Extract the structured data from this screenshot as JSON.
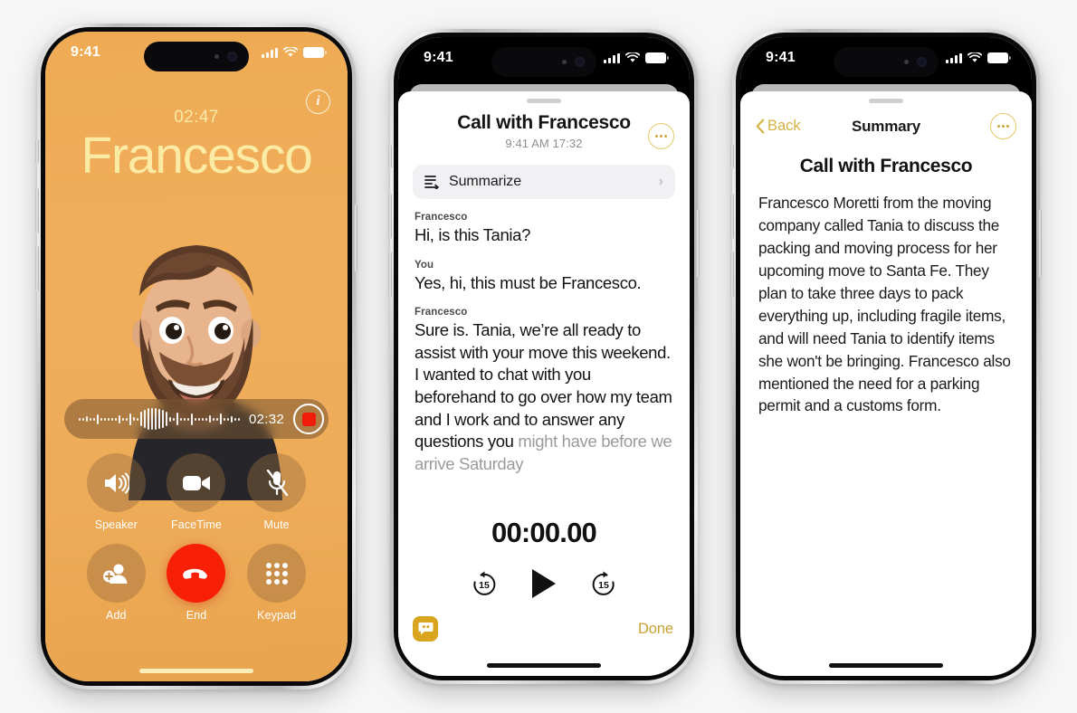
{
  "page": {
    "background_color": "#f6f6f7",
    "accent_gold": "#d4a72c",
    "call_screen_bg": "#efab54",
    "name_color": "#fbeba4",
    "end_button_color": "#f81f07"
  },
  "phone1": {
    "status_bar": {
      "time": "9:41",
      "signal_icon": "cellular-bars-icon",
      "wifi_icon": "wifi-icon",
      "battery_icon": "battery-icon"
    },
    "info_button": "i",
    "call_timer": "02:47",
    "caller_name": "Francesco",
    "avatar": "memoji-avatar",
    "recording": {
      "waveform_icon": "audio-waveform",
      "elapsed": "02:32",
      "record_button": "record-stop-button"
    },
    "controls": [
      {
        "label": "Speaker",
        "icon": "speaker-icon"
      },
      {
        "label": "FaceTime",
        "icon": "video-camera-icon"
      },
      {
        "label": "Mute",
        "icon": "microphone-muted-icon"
      },
      {
        "label": "Add",
        "icon": "add-person-icon"
      },
      {
        "label": "End",
        "icon": "end-call-icon"
      },
      {
        "label": "Keypad",
        "icon": "keypad-grid-icon"
      }
    ]
  },
  "phone2": {
    "status_bar": {
      "time": "9:41"
    },
    "title": "Call with Francesco",
    "subtitle": "9:41 AM  17:32",
    "more_button": "more-options-icon",
    "summarize": {
      "label": "Summarize",
      "icon": "summarize-lines-icon",
      "chevron": "›"
    },
    "transcript": [
      {
        "speaker": "Francesco",
        "text": "Hi, is this Tania?",
        "faded": false
      },
      {
        "speaker": "You",
        "text": "Yes, hi, this must be Francesco.",
        "faded": false
      },
      {
        "speaker": "Francesco",
        "text": "Sure is. Tania, we’re all ready to assist with your move this weekend. I wanted to chat with you beforehand to go over how my team and I work and to answer any questions you ",
        "faded": false,
        "tail": "might have before we arrive Saturday"
      }
    ],
    "player": {
      "time": "00:00.00",
      "rewind_label": "15",
      "forward_label": "15",
      "play_icon": "play-icon",
      "rewind_icon": "rewind-15-icon",
      "forward_icon": "forward-15-icon"
    },
    "footer": {
      "live_icon": "live-transcription-icon",
      "done_label": "Done"
    }
  },
  "phone3": {
    "status_bar": {
      "time": "9:41"
    },
    "back_label": "Back",
    "nav_title": "Summary",
    "more_button": "more-options-icon",
    "summary_title": "Call with Francesco",
    "summary_body": "Francesco Moretti from the moving company called Tania to discuss the packing and moving process for her upcoming move to Santa Fe. They plan to take three days to pack everything up, including fragile items, and will need Tania to identify items she won't be bringing. Francesco also mentioned the need for a parking permit and a customs form."
  }
}
